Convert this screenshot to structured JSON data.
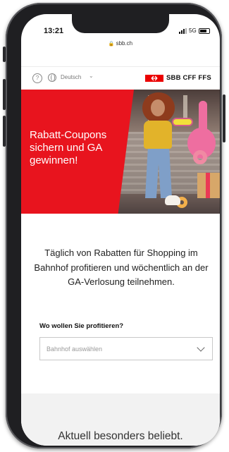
{
  "status_bar": {
    "time": "13:21",
    "network": "5G",
    "url": "sbb.ch"
  },
  "header": {
    "language": "Deutsch",
    "logo_text": "SBB CFF FFS",
    "brand_color": "#eb0000",
    "icons": [
      "help-icon",
      "globe-icon",
      "chevron-down-icon",
      "sbb-logo-icon"
    ]
  },
  "hero": {
    "headline": "Rabatt-Coupons sichern und GA gewinnen!",
    "accent_color": "#e8141e"
  },
  "main": {
    "intro": "Täglich von Rabatten für Shopping im Bahnhof profitieren und wöchentlich an der GA-Verlosung teilnehmen.",
    "question": "Wo wollen Sie profitieren?",
    "select_placeholder": "Bahnhof auswählen",
    "section_title": "Aktuell besonders beliebt."
  }
}
